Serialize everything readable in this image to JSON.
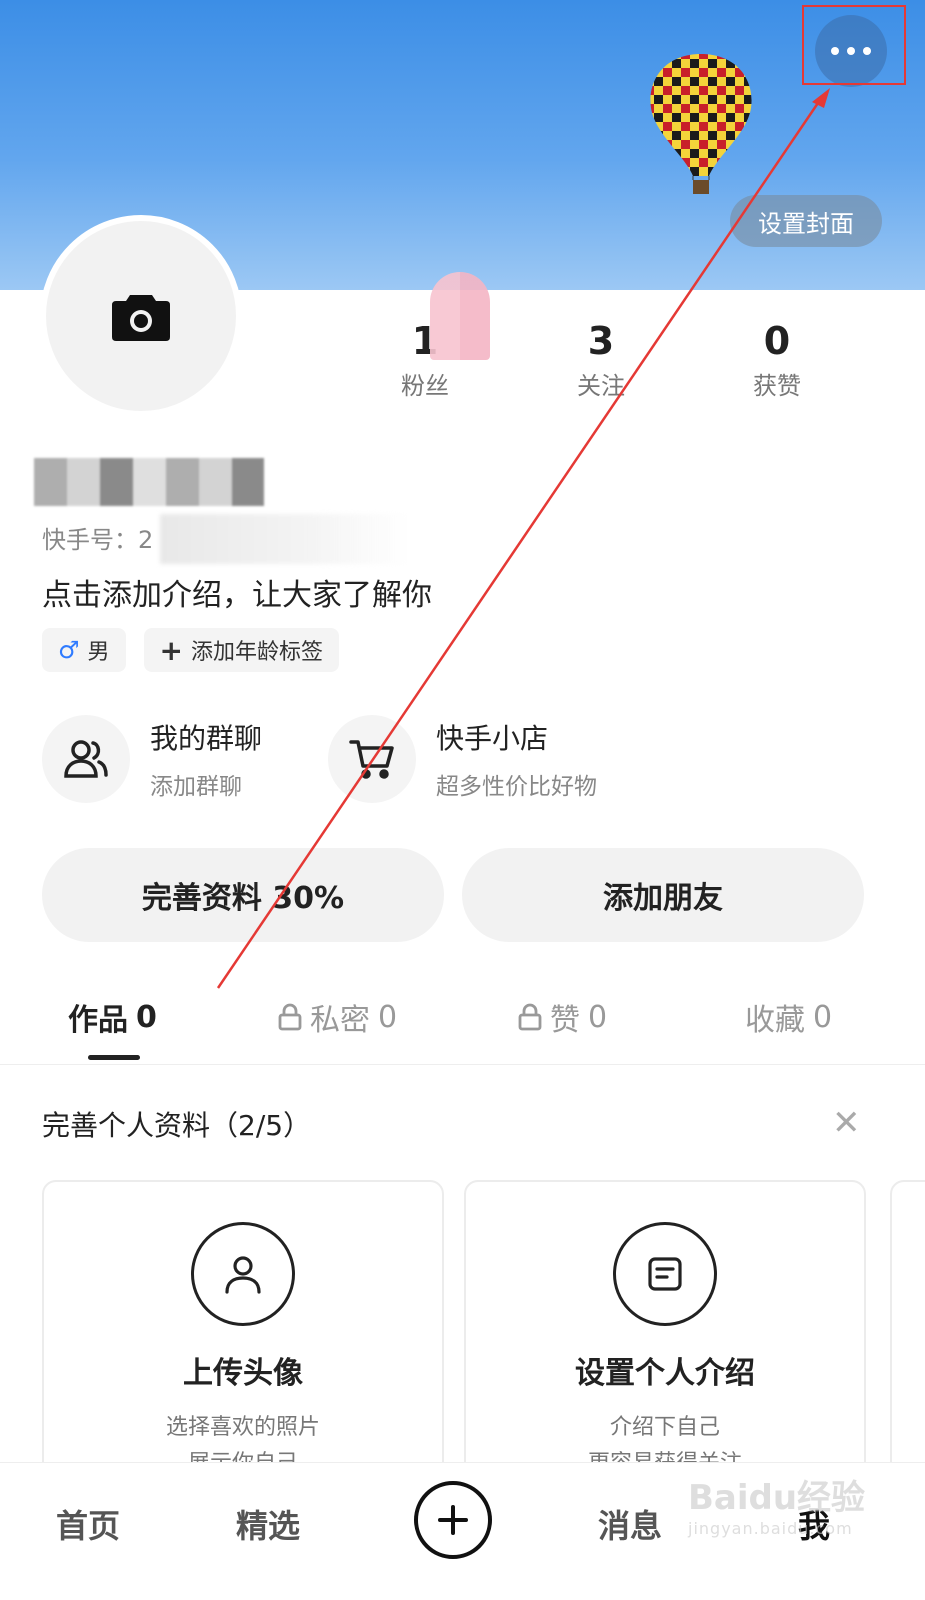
{
  "header": {
    "set_cover_label": "设置封面",
    "more_icon": "more-horizontal-icon"
  },
  "stats": [
    {
      "value": "1",
      "label": "粉丝"
    },
    {
      "value": "3",
      "label": "关注"
    },
    {
      "value": "0",
      "label": "获赞"
    }
  ],
  "profile": {
    "kwai_id_label": "快手号：2",
    "bio": "点击添加介绍，让大家了解你",
    "tags": [
      {
        "icon": "male-icon",
        "label": "男"
      },
      {
        "icon": "plus-icon",
        "label": "添加年龄标签"
      }
    ]
  },
  "shortcuts": [
    {
      "icon": "group-chat-icon",
      "title": "我的群聊",
      "subtitle": "添加群聊"
    },
    {
      "icon": "cart-icon",
      "title": "快手小店",
      "subtitle": "超多性价比好物"
    }
  ],
  "actions": {
    "complete_profile": "完善资料 30%",
    "add_friends": "添加朋友"
  },
  "tabs": [
    {
      "label": "作品",
      "count": "0",
      "locked": false,
      "active": true
    },
    {
      "label": "私密",
      "count": "0",
      "locked": true,
      "active": false
    },
    {
      "label": "赞",
      "count": "0",
      "locked": true,
      "active": false
    },
    {
      "label": "收藏",
      "count": "0",
      "locked": false,
      "active": false
    }
  ],
  "complete_section": {
    "title": "完善个人资料（2/5）",
    "cards": [
      {
        "icon": "user-icon",
        "title": "上传头像",
        "line1": "选择喜欢的照片",
        "line2": "展示你自己"
      },
      {
        "icon": "document-icon",
        "title": "设置个人介绍",
        "line1": "介绍下自己",
        "line2": "更容易获得关注"
      }
    ]
  },
  "bottom_nav": {
    "home": "首页",
    "featured": "精选",
    "messages": "消息",
    "me": "我"
  },
  "watermark": {
    "brand": "Baidu经验",
    "url": "jingyan.baidu.com"
  },
  "colors": {
    "accent_red": "#e53935",
    "male_blue": "#2f7bff",
    "cover_blue": "#4a98ea"
  }
}
